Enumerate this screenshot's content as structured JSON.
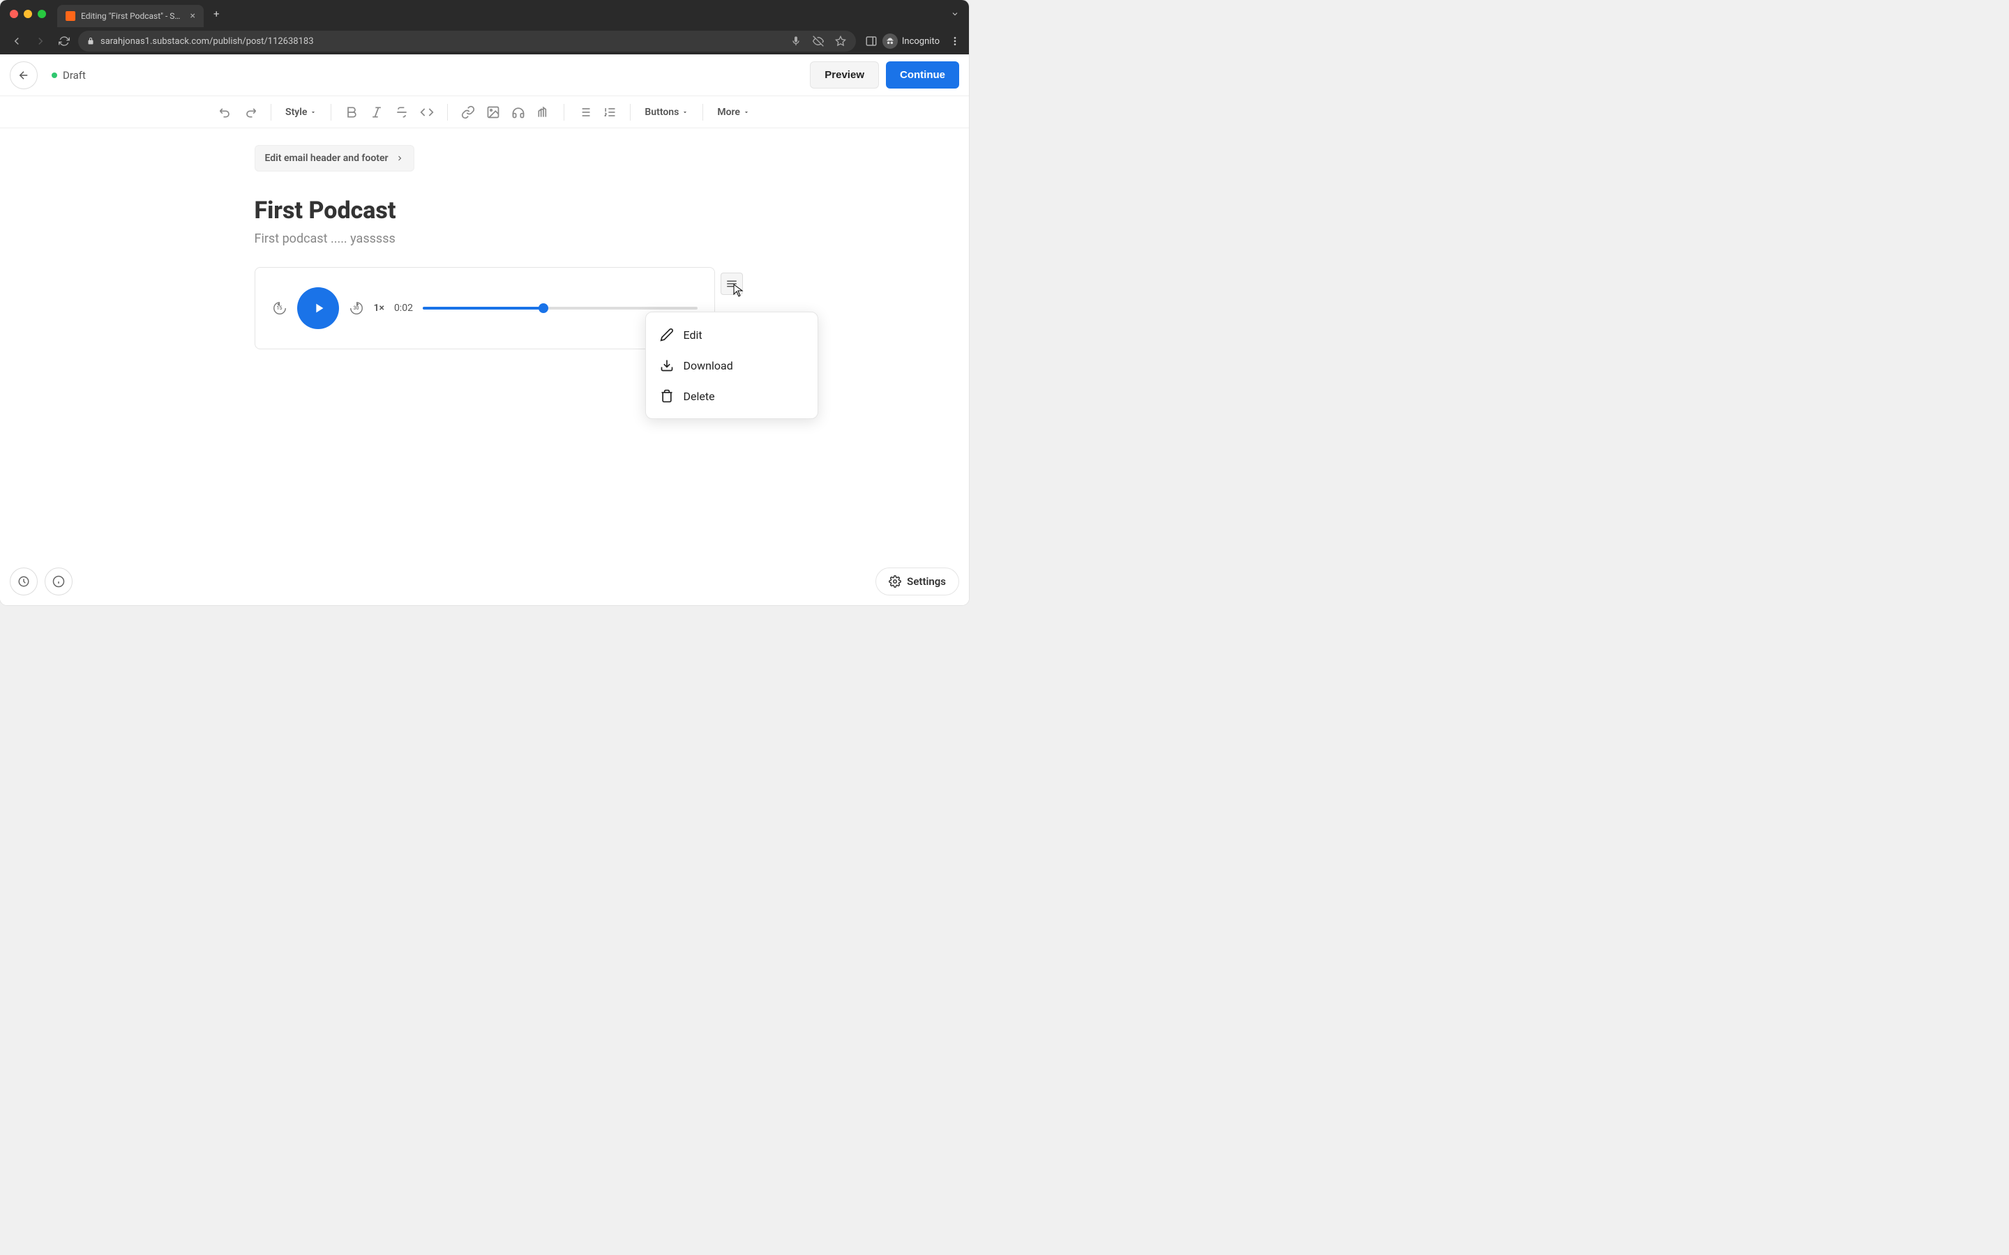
{
  "browser": {
    "tab_title": "Editing \"First Podcast\" - Subst",
    "url": "sarahjonas1.substack.com/publish/post/112638183",
    "incognito_label": "Incognito"
  },
  "header": {
    "status_label": "Draft",
    "preview_label": "Preview",
    "continue_label": "Continue"
  },
  "toolbar": {
    "style_label": "Style",
    "buttons_label": "Buttons",
    "more_label": "More"
  },
  "editor": {
    "edit_header_label": "Edit email header and footer",
    "post_title": "First Podcast",
    "post_subtitle": "First podcast ..... yasssss"
  },
  "audio": {
    "skip_back": "15",
    "skip_fwd": "30",
    "speed": "1×",
    "time_current": "0:02",
    "progress_pct": 44
  },
  "menu": {
    "edit": "Edit",
    "download": "Download",
    "delete": "Delete"
  },
  "footer": {
    "settings_label": "Settings"
  }
}
